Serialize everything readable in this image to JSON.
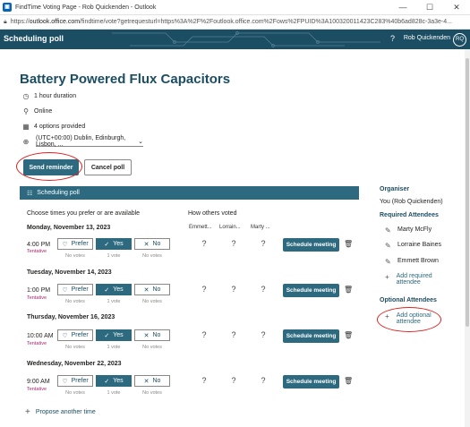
{
  "window": {
    "title": "FindTime Voting Page - Rob Quickenden - Outlook",
    "minimize": "—",
    "maximize": "☐",
    "close": "✕"
  },
  "address": {
    "prefix": "https://",
    "host": "outlook.office.com",
    "path": "/findtime/vote?getrequesturl=https%3A%2F%2Foutlook.office.com%2Fows%2FPUID%3A100320011423C283%40b6ad828c-3a3e-4..."
  },
  "topbar": {
    "app_name": "Scheduling poll",
    "help": "?",
    "user_name": "Rob Quickenden",
    "user_initials": "RQ"
  },
  "meeting": {
    "title": "Battery Powered Flux Capacitors",
    "duration": "1 hour duration",
    "location": "Online",
    "options_count": "4 options provided",
    "timezone": "(UTC+00:00) Dublin, Edinburgh, Lisbon, ..."
  },
  "actions": {
    "send_reminder": "Send reminder",
    "cancel_poll": "Cancel poll"
  },
  "poll": {
    "header": "Scheduling poll",
    "choose_label": "Choose times you prefer or are available",
    "others_label": "How others voted",
    "attendees": [
      "Emmett...",
      "Lorrain...",
      "Marty ..."
    ],
    "prefer": "Prefer",
    "yes": "Yes",
    "no": "No",
    "schedule": "Schedule meeting",
    "rows": [
      {
        "date": "Monday, November 13, 2023",
        "time": "4:00 PM",
        "status": "Tentative",
        "prefer_votes": "No votes",
        "yes_votes": "1 vote",
        "no_votes": "No votes",
        "others": [
          "?",
          "?",
          "?"
        ]
      },
      {
        "date": "Tuesday, November 14, 2023",
        "time": "1:00 PM",
        "status": "Tentative",
        "prefer_votes": "No votes",
        "yes_votes": "1 vote",
        "no_votes": "No votes",
        "others": [
          "?",
          "?",
          "?"
        ]
      },
      {
        "date": "Thursday, November 16, 2023",
        "time": "10:00 AM",
        "status": "Tentative",
        "prefer_votes": "No votes",
        "yes_votes": "1 vote",
        "no_votes": "No votes",
        "others": [
          "?",
          "?",
          "?"
        ]
      },
      {
        "date": "Wednesday, November 22, 2023",
        "time": "9:00 AM",
        "status": "Tentative",
        "prefer_votes": "No votes",
        "yes_votes": "1 vote",
        "no_votes": "No votes",
        "others": [
          "?",
          "?",
          "?"
        ]
      }
    ],
    "propose": "Propose another time"
  },
  "sidebar": {
    "organiser_label": "Organiser",
    "organiser": "You (Rob Quickenden)",
    "required_label": "Required Attendees",
    "required": [
      "Marty McFly",
      "Lorraine Baines",
      "Emmett Brown"
    ],
    "add_required": "Add required attendee",
    "optional_label": "Optional Attendees",
    "add_optional": "Add optional attendee"
  },
  "colors": {
    "accent": "#2d6a80",
    "banner": "#1b4d63",
    "annotation": "#dd2222",
    "tentative": "#b1226d"
  },
  "icons": {
    "clock": "clock-icon",
    "location": "location-pin-icon",
    "calendar": "calendar-icon",
    "globe": "globe-icon",
    "poll": "poll-icon",
    "heart": "heart-icon",
    "check": "checkmark-icon",
    "x": "x-icon",
    "trash": "trash-icon",
    "pencil": "pencil-icon",
    "plus": "plus-icon"
  }
}
